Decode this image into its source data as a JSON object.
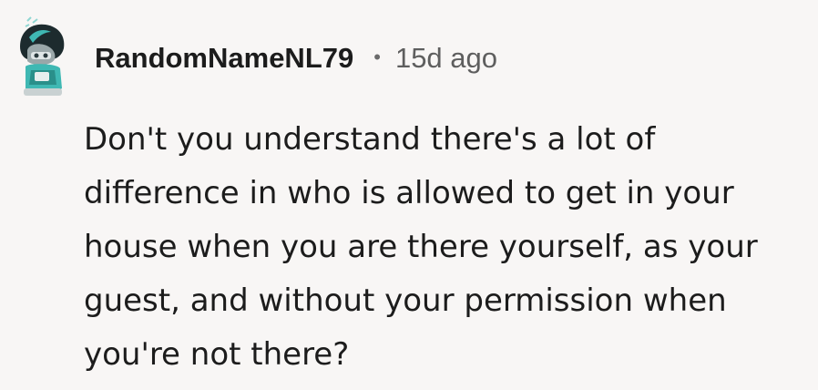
{
  "comment": {
    "author": "RandomNameNL79",
    "separator": "•",
    "timestamp": "15d ago",
    "avatar_icon": "snoo-avatar-icon",
    "body_lines": [
      "Don't you understand there's a lot of",
      "difference in who is allowed to get in your",
      "house when you are there yourself, as your",
      "guest, and without your permission when",
      "you're not there?"
    ]
  },
  "colors": {
    "background": "#f8f6f5",
    "text": "#1c1c1c",
    "meta_text": "#5e5e5e",
    "avatar_accent": "#3fb8b3"
  }
}
